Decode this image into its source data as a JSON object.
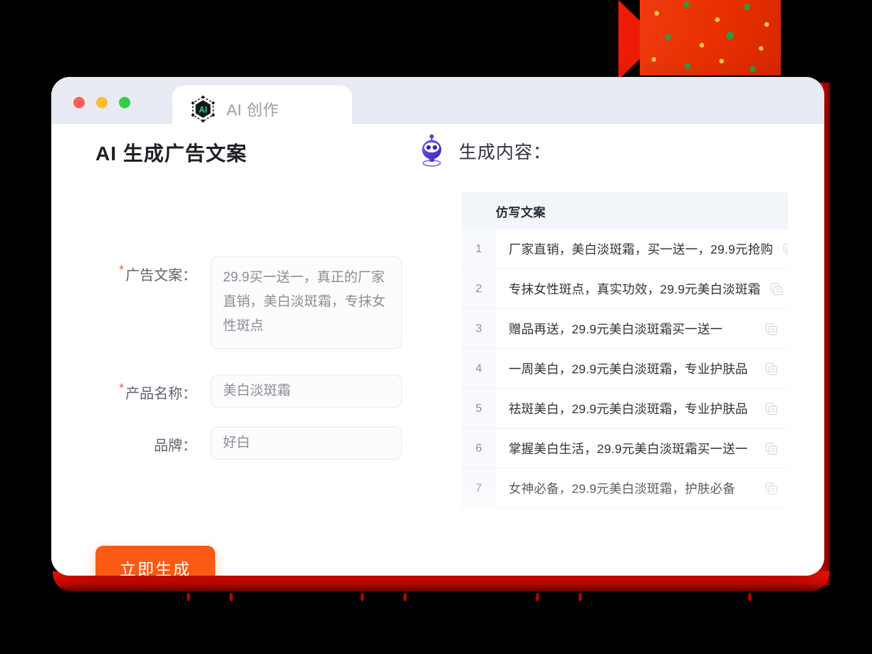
{
  "window": {
    "traffic_lights": [
      "close",
      "minimize",
      "maximize"
    ],
    "tab": {
      "label": "AI 创作",
      "logo_icon": "ai-hexagon-logo-icon",
      "logo_text": "AI"
    }
  },
  "form": {
    "title": "AI 生成广告文案",
    "required_marker": "*",
    "fields": [
      {
        "label": "广告文案：",
        "required": true,
        "value": "29.9买一送一，真正的厂家直销，美白淡斑霜，专抹女性斑点",
        "type": "textarea"
      },
      {
        "label": "产品名称：",
        "required": true,
        "value": "美白淡斑霜",
        "type": "input"
      },
      {
        "label": "品牌：",
        "required": false,
        "value": "好白",
        "type": "input"
      }
    ],
    "submit_label": "立即生成",
    "submit_color": "#fa5a14"
  },
  "result": {
    "icon": "robot-icon",
    "title": "生成内容：",
    "table": {
      "columns": [
        "",
        "仿写文案",
        ""
      ],
      "header_text": "仿写文案",
      "copy_icon": "copy-icon",
      "rows": [
        {
          "index": "1",
          "text": "厂家直销，美白淡斑霜，买一送一，29.9元抢购"
        },
        {
          "index": "2",
          "text": "专抹女性斑点，真实功效，29.9元美白淡斑霜"
        },
        {
          "index": "3",
          "text": "赠品再送，29.9元美白淡斑霜买一送一"
        },
        {
          "index": "4",
          "text": "一周美白，29.9元美白淡斑霜，专业护肤品"
        },
        {
          "index": "5",
          "text": "祛斑美白，29.9元美白淡斑霜，专业护肤品"
        },
        {
          "index": "6",
          "text": "掌握美白生活，29.9元美白淡斑霜买一送一"
        },
        {
          "index": "7",
          "text": "女神必备，29.9元美白淡斑霜，护肤必备"
        }
      ]
    }
  },
  "theme": {
    "accent_orange": "#fa5a14",
    "required_star": "#f4623a",
    "titlebar_bg": "#e9ebf4",
    "table_header_bg": "#f2f5fa",
    "decor_red": "#ee1c06",
    "robot_purple": "#5a3fd8",
    "logo_green": "#25d97a"
  }
}
